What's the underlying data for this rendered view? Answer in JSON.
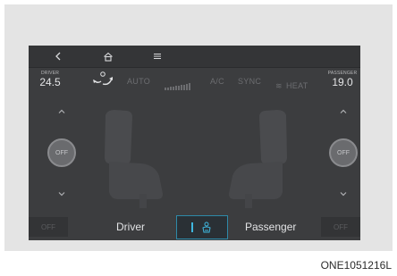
{
  "header_temps": {
    "driver": {
      "label": "DRIVER",
      "value": "24.5"
    },
    "passenger": {
      "label": "PASSENGER",
      "value": "19.0"
    }
  },
  "modes": {
    "auto": "AUTO",
    "ac": "A/C",
    "sync": "SYNC",
    "heat": "HEAT"
  },
  "seat_controls": {
    "left_off": "OFF",
    "right_off": "OFF"
  },
  "bottom": {
    "left_off": "OFF",
    "driver": "Driver",
    "passenger": "Passenger",
    "right_off": "OFF"
  },
  "caption": "ONE1051216L",
  "colors": {
    "screen_bg": "#3c3d3f",
    "accent": "#3fb7df",
    "frame_bg": "#e4e4e4"
  },
  "icons": {
    "nav": [
      "back-icon",
      "home-icon",
      "menu-icon"
    ],
    "airflow": "airflow-mode-icon",
    "fan": "fan-speed-icon",
    "sync_button": "seat-heat-icon"
  }
}
